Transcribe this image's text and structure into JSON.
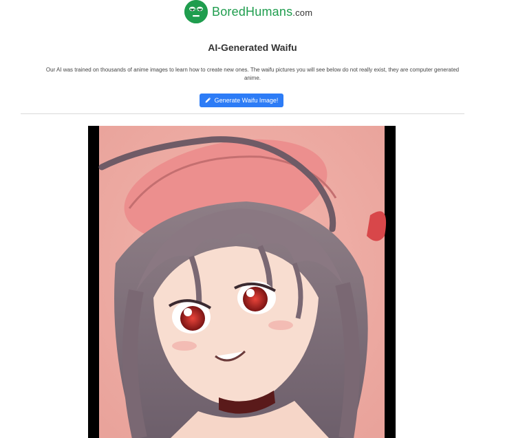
{
  "header": {
    "logo_icon": "smiley-face-icon",
    "logo_part1": "Bored",
    "logo_part2": "Humans",
    "logo_part3": ".com",
    "brand_color": "#1f9d4e"
  },
  "main": {
    "title": "AI-Generated Waifu",
    "description_line1": "Our AI was trained on thousands of anime images to learn how to create new ones. The waifu pictures you will see below do not really exist, they are computer generated",
    "description_line2": "anime.",
    "generate_button_label": "Generate Waifu Image!",
    "generate_button_icon": "pencil-icon",
    "button_color": "#2d7cf6"
  },
  "image": {
    "description": "ai-generated-anime-waifu-portrait"
  }
}
